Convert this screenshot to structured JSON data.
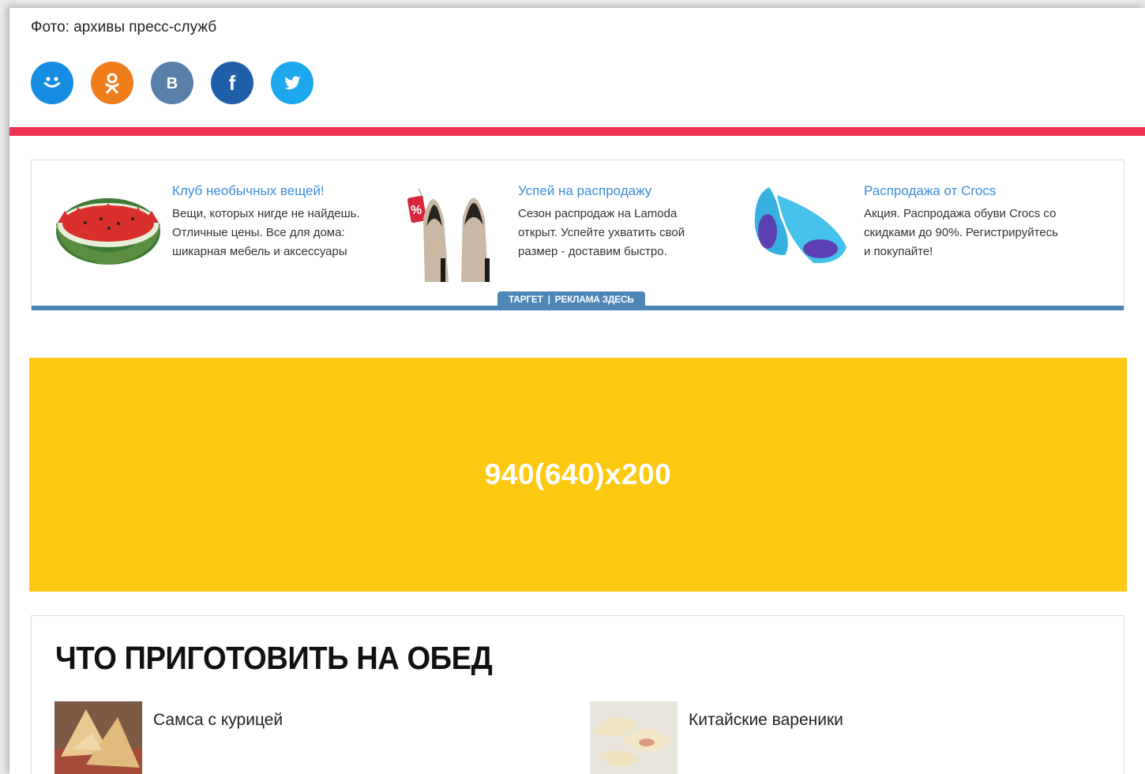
{
  "photo_credit": "Фото: архивы пресс-служб",
  "share": [
    {
      "network": "moimir",
      "icon": "moimir-icon",
      "color": "#168de2"
    },
    {
      "network": "odnoklassniki",
      "icon": "odnoklassniki-icon",
      "color": "#ef7d1b"
    },
    {
      "network": "vkontakte",
      "icon": "vk-icon",
      "glyph": "B",
      "color": "#5a7fa8"
    },
    {
      "network": "facebook",
      "icon": "facebook-icon",
      "glyph": "f",
      "color": "#1f5fa9"
    },
    {
      "network": "twitter",
      "icon": "twitter-icon",
      "color": "#1da7ec"
    }
  ],
  "divider_color": "#ef3352",
  "target_ads": {
    "items": [
      {
        "title": "Клуб необычных вещей!",
        "description": "Вещи, которых нигде не найдешь. Отличные цены. Все для дома: шикарная мебель и аксессуары",
        "image": "watermelon-bowl-image"
      },
      {
        "title": "Успей на распродажу",
        "description": "Сезон распродаж на Lamoda открыт. Успейте ухватить свой размер - доставим быстро.",
        "image": "high-heels-image"
      },
      {
        "title": "Распродажа от Crocs",
        "description": "Акция. Распродажа обуви Crocs со скидками до 90%. Регистрируйтесь и покупайте!",
        "image": "crocs-shoes-image"
      }
    ],
    "tag_left": "ТАРГЕТ",
    "tag_right": "РЕКЛАМА ЗДЕСЬ",
    "accent": "#4e86b8"
  },
  "banner": {
    "text": "940(640)x200",
    "color": "#fdc911"
  },
  "lunch": {
    "title": "ЧТО ПРИГОТОВИТЬ НА ОБЕД",
    "recipes": [
      {
        "name": "Самса с курицей",
        "image": "samsa-image"
      },
      {
        "name": "Китайские вареники",
        "image": "dumplings-image"
      }
    ]
  }
}
